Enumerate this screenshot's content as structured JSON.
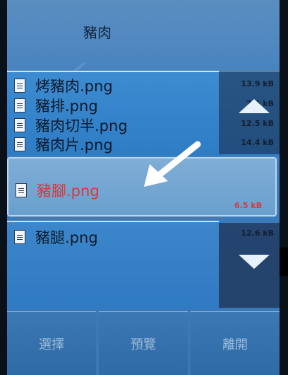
{
  "header": {
    "title": "豬肉"
  },
  "files_top": [
    {
      "name": "烤豬肉.png",
      "size": "13.9 kB"
    },
    {
      "name": "豬排.png",
      "size": "7.6 kB"
    },
    {
      "name": "豬肉切半.png",
      "size": "12.5 kB"
    },
    {
      "name": "豬肉片.png",
      "size": "14.4 kB"
    }
  ],
  "selected_file": {
    "name": "豬腳.png",
    "size": "6.5 kB"
  },
  "files_bottom": [
    {
      "name": "豬腿.png",
      "size": "12.6 kB"
    }
  ],
  "toolbar": {
    "select_label": "選擇",
    "preview_label": "預覽",
    "exit_label": "離開"
  },
  "icons": {
    "file": "file-icon",
    "scroll_up": "up-arrow-icon",
    "scroll_down": "down-arrow-icon",
    "pointer": "arrow-pointer-icon"
  },
  "colors": {
    "selected_text": "#d8373a",
    "background": "#3a78b8"
  }
}
